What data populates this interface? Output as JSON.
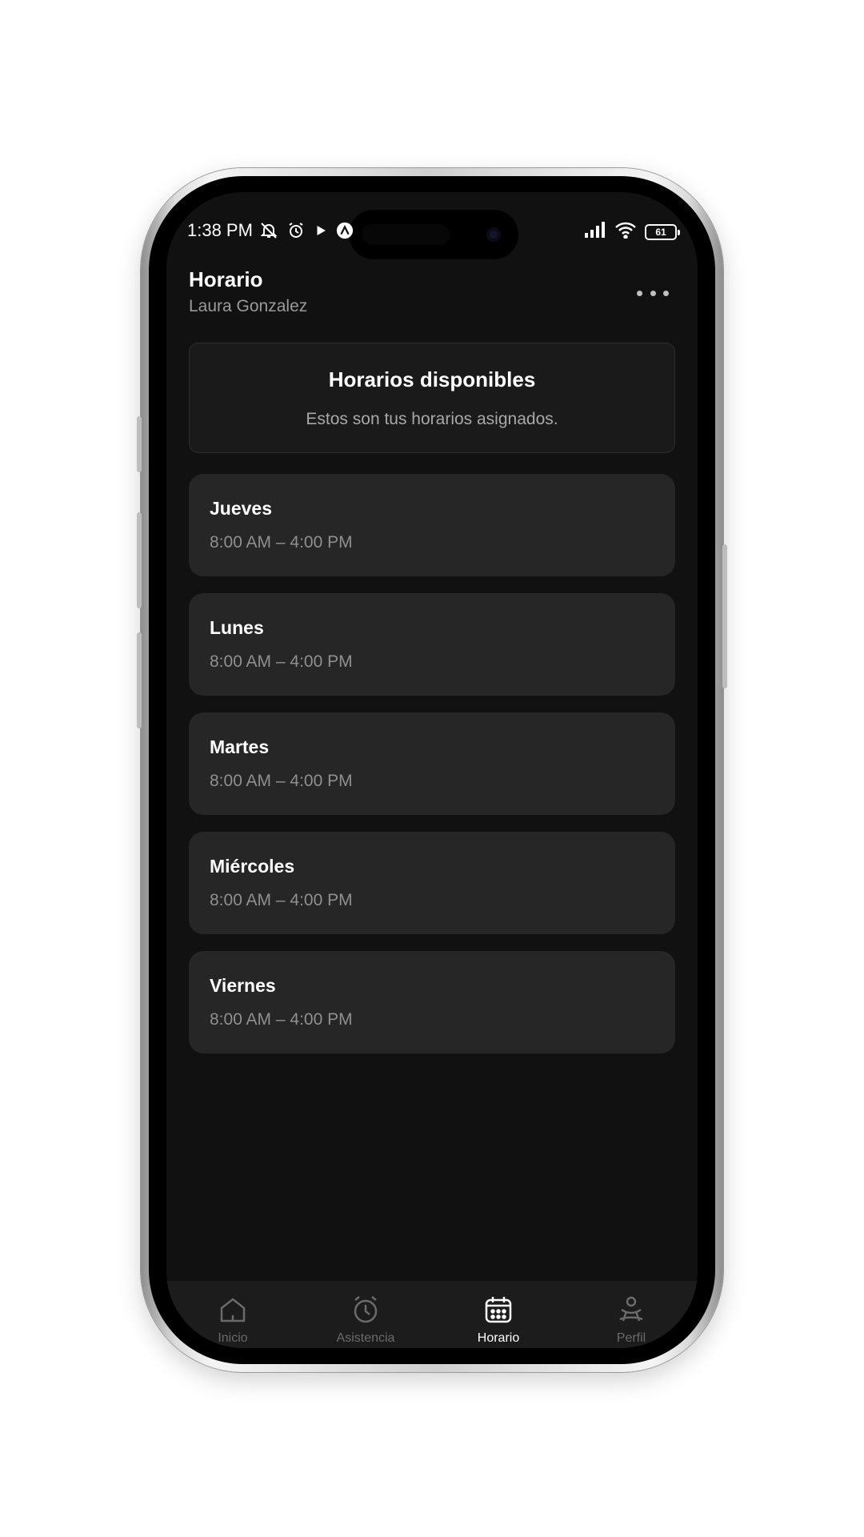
{
  "status_bar": {
    "time": "1:38 PM",
    "battery": "61",
    "left_icons": [
      "mute-icon",
      "alarm-icon",
      "play-icon",
      "app-icon"
    ],
    "right_icons": [
      "signal-icon",
      "wifi-icon",
      "battery-icon"
    ]
  },
  "header": {
    "title": "Horario",
    "subtitle": "Laura Gonzalez",
    "more_icon": "more-dots-icon"
  },
  "info_card": {
    "title": "Horarios disponibles",
    "description": "Estos son tus horarios asignados."
  },
  "schedule": [
    {
      "day": "Jueves",
      "hours": "8:00 AM – 4:00 PM"
    },
    {
      "day": "Lunes",
      "hours": "8:00 AM – 4:00 PM"
    },
    {
      "day": "Martes",
      "hours": "8:00 AM – 4:00 PM"
    },
    {
      "day": "Miércoles",
      "hours": "8:00 AM – 4:00 PM"
    },
    {
      "day": "Viernes",
      "hours": "8:00 AM – 4:00 PM"
    }
  ],
  "tabs": [
    {
      "label": "Inicio",
      "icon": "home-icon",
      "active": false
    },
    {
      "label": "Asistencia",
      "icon": "clock-icon",
      "active": false
    },
    {
      "label": "Horario",
      "icon": "calendar-icon",
      "active": true
    },
    {
      "label": "Perfil",
      "icon": "person-icon",
      "active": false
    }
  ],
  "colors": {
    "background": "#111111",
    "card": "#262626",
    "text_primary": "#ffffff",
    "text_secondary": "#8f8f8f",
    "tab_inactive": "#6a6a6a"
  }
}
